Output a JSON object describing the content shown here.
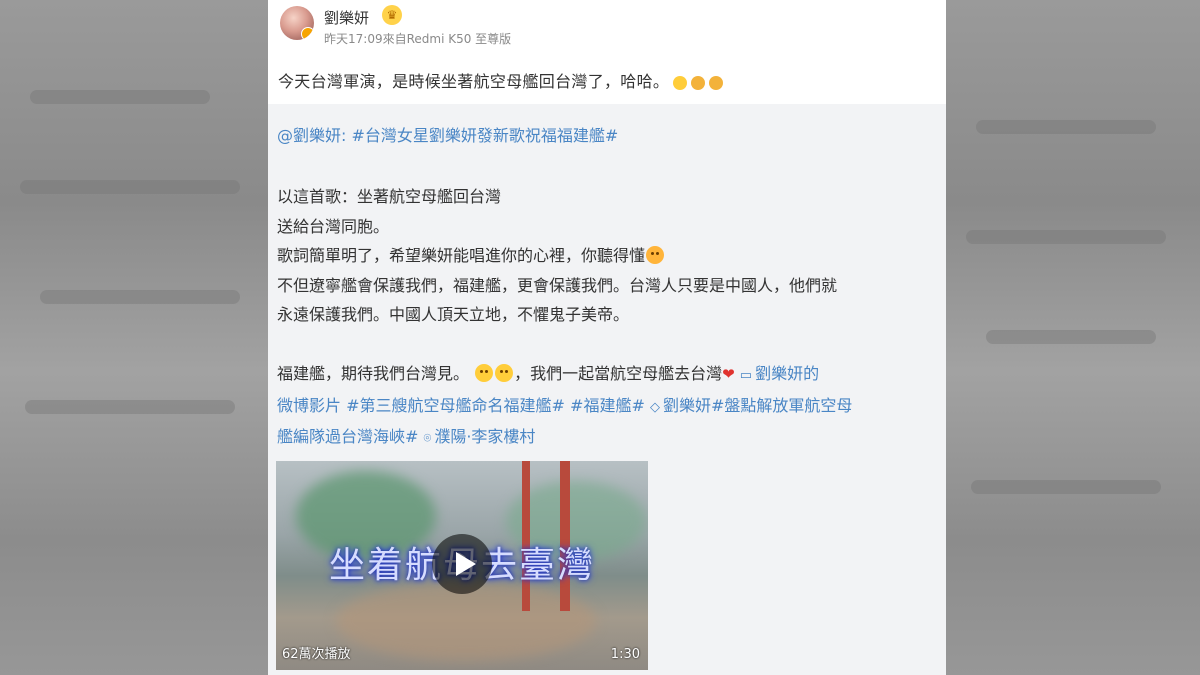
{
  "post": {
    "username": "劉樂妍",
    "meta": "昨天17:09來自Redmi K50 至尊版",
    "text": "今天台灣軍演，是時候坐著航空母艦回台灣了，哈哈。"
  },
  "repost": {
    "mention": "@劉樂妍:",
    "hashtag": "#台灣女星劉樂妍發新歌祝福福建艦#",
    "line1": "以這首歌：坐著航空母艦回台灣",
    "line2": "送給台灣同胞。",
    "line3": "歌詞簡單明了，希望樂妍能唱進你的心裡，你聽得懂",
    "line4": "不但遼寧艦會保護我們，福建艦，更會保護我們。台灣人只要是中國人，他們就",
    "line5": "永遠保護我們。中國人頂天立地，不懼鬼子美帝。",
    "line6_a": "福建艦，期待我們台灣見。",
    "line6_b": "，我們一起當航空母艦去台灣",
    "video_link_a": "劉樂妍的",
    "video_link_b": "微博影片",
    "tag1": "#第三艘航空母艦命名福建艦#",
    "tag2": "#福建艦#",
    "super_link": "劉樂妍",
    "tag3a": "#盤點解放軍航空母",
    "tag3b": "艦編隊過台灣海峽#",
    "location": "濮陽·李家樓村"
  },
  "video": {
    "title": "坐着航母去臺灣",
    "views": "62萬次播放",
    "duration": "1:30"
  },
  "icons": [
    "crown-badge-icon",
    "verified-badge-icon",
    "laugh-emoji-icon",
    "fist-emoji-icon",
    "kiss-emoji-icon",
    "grin-emoji-icon",
    "smile-emoji-icon",
    "heart-icon",
    "video-camera-icon",
    "diamond-icon",
    "location-pin-icon",
    "play-icon"
  ]
}
